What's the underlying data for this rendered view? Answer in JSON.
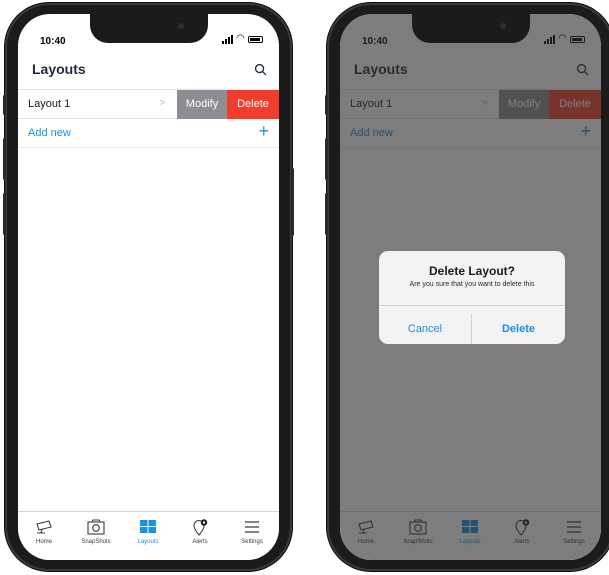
{
  "status": {
    "time": "10:40"
  },
  "screen": {
    "title": "Layouts",
    "layouts": [
      {
        "name": "Layout 1"
      }
    ],
    "swipe_actions": {
      "modify": "Modify",
      "delete": "Delete"
    },
    "add_new": "Add new"
  },
  "tabs": [
    {
      "label": "Home",
      "icon": "camera-icon"
    },
    {
      "label": "SnapShots",
      "icon": "snapshot-icon"
    },
    {
      "label": "Layouts",
      "icon": "layouts-icon",
      "active": true
    },
    {
      "label": "Alerts",
      "icon": "alert-pin-icon"
    },
    {
      "label": "Settings",
      "icon": "menu-icon"
    }
  ],
  "dialog": {
    "title": "Delete Layout?",
    "message": "Are you sure that you want to delete this",
    "cancel": "Cancel",
    "confirm": "Delete"
  },
  "colors": {
    "accent": "#1b8fe0",
    "delete": "#f23d2e",
    "modify": "#8d8d93",
    "title": "#1c2b3c"
  }
}
